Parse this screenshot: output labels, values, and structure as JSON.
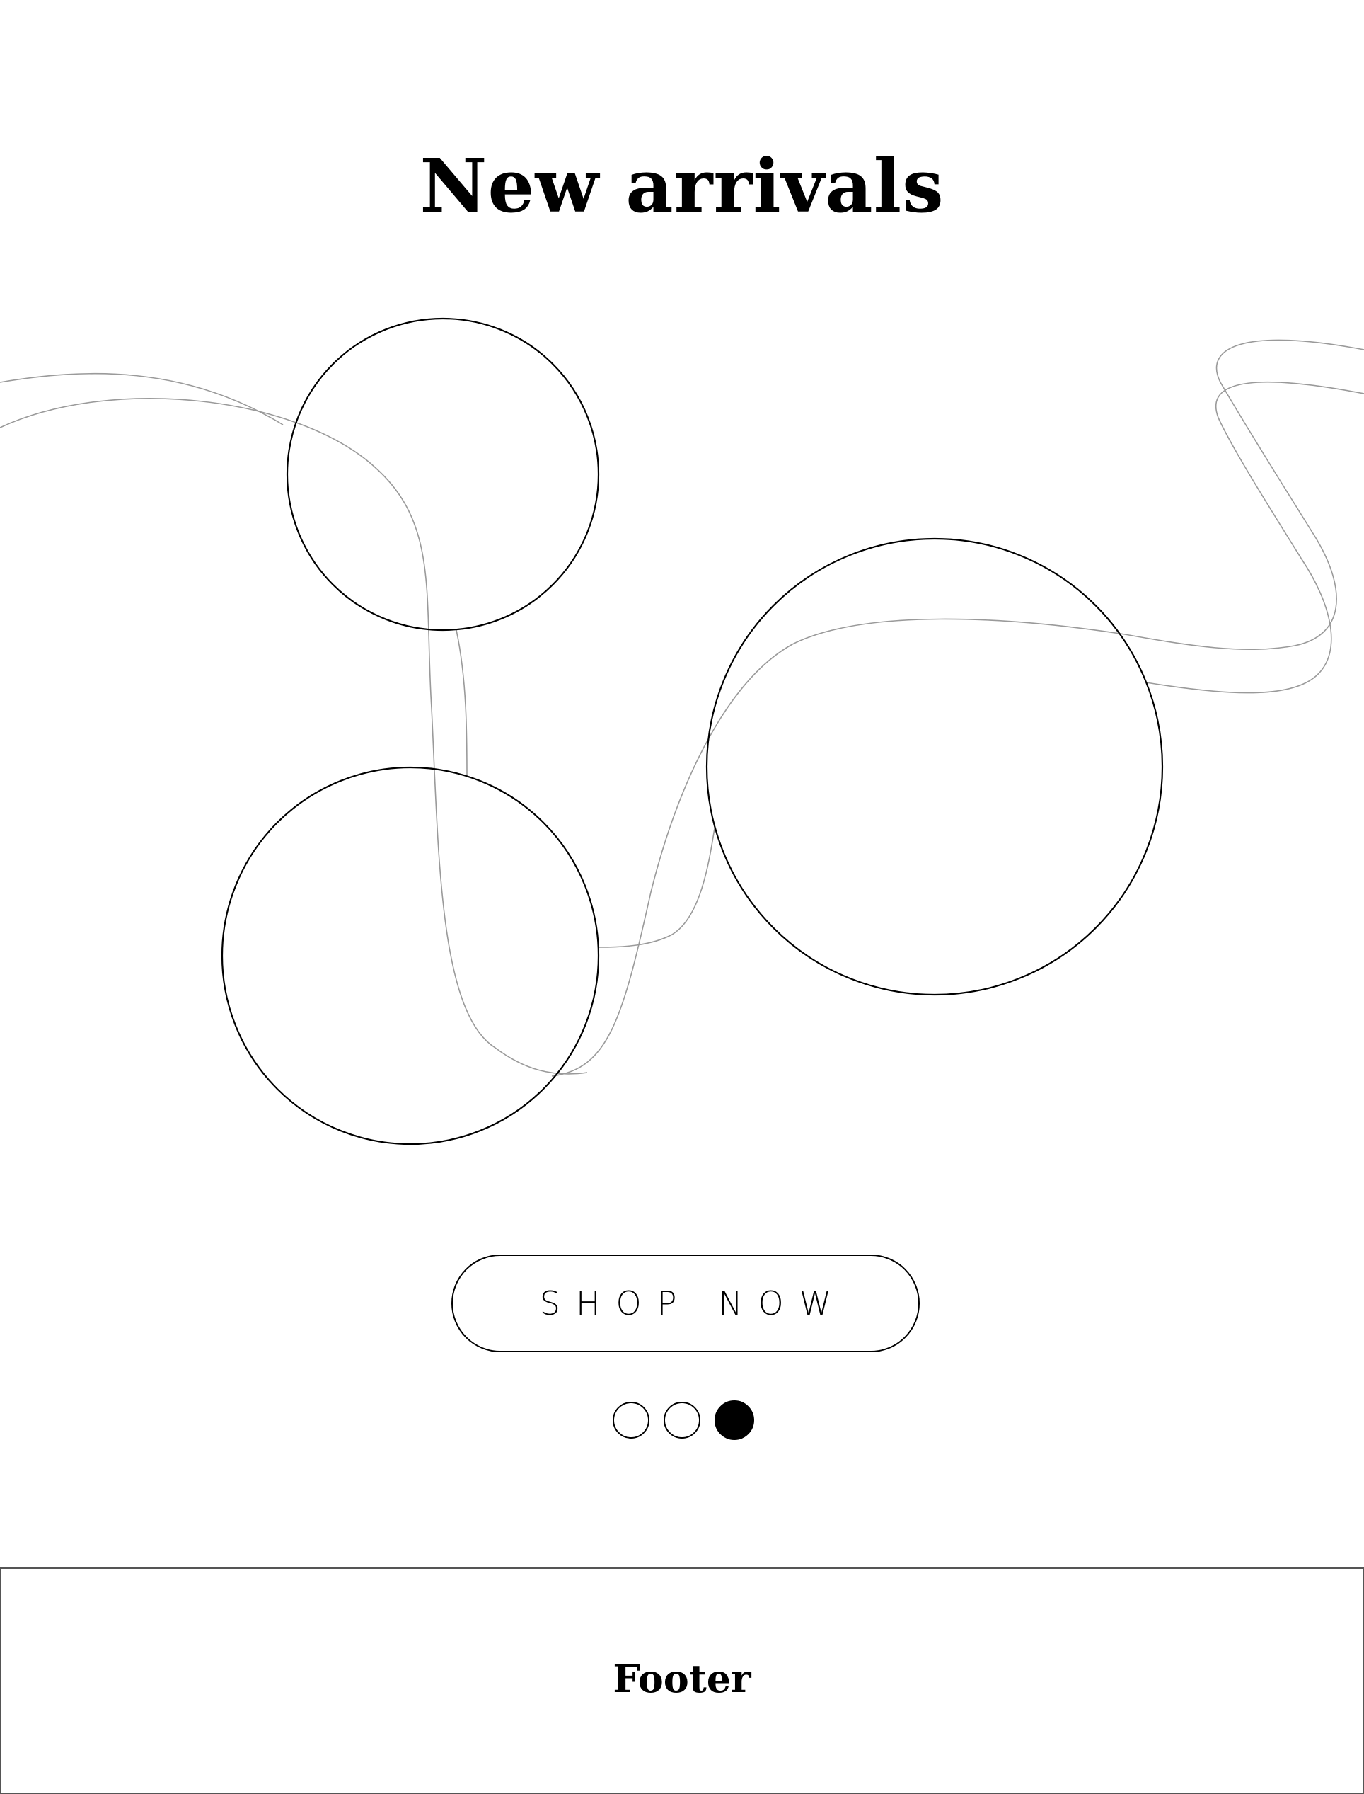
{
  "hero": {
    "title": "New arrivals",
    "cta_label": "SHOP NOW"
  },
  "carousel": {
    "slide_count": 3,
    "active_index": 2,
    "dot_icons": [
      "circle-outline-icon",
      "circle-outline-icon",
      "circle-filled-icon"
    ]
  },
  "footer": {
    "label": "Footer"
  },
  "colors": {
    "background": "#ffffff",
    "text": "#000000",
    "circle_stroke": "#000000",
    "ribbon_stroke": "#9a9a9a",
    "footer_border": "#555555"
  }
}
